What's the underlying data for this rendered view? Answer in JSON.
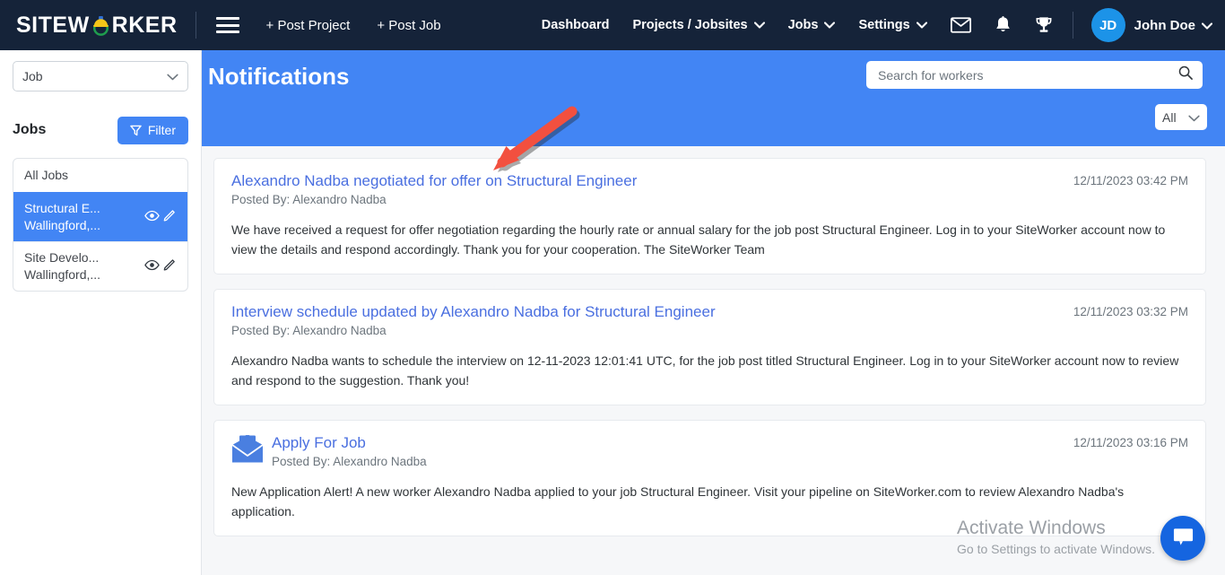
{
  "navbar": {
    "logo_text_left": "SITEW",
    "logo_icon": "safety-helmet-o-icon",
    "logo_text_right": "RKER",
    "menu_icon": "hamburger-icon",
    "post_project": "+ Post Project",
    "post_job": "+ Post Job",
    "items": [
      {
        "label": "Dashboard",
        "caret": false
      },
      {
        "label": "Projects / Jobsites",
        "caret": true
      },
      {
        "label": "Jobs",
        "caret": true
      },
      {
        "label": "Settings",
        "caret": true
      }
    ],
    "icons": [
      "mail-icon",
      "bell-icon",
      "trophy-icon"
    ],
    "avatar_initials": "JD",
    "username": "John Doe",
    "caret_glyph": "∨"
  },
  "sidebar": {
    "entity_select": {
      "value": "Job",
      "caret": "⌄"
    },
    "jobs_label": "Jobs",
    "filter_button": "Filter",
    "jobs": [
      {
        "line1": "All Jobs",
        "line2": "",
        "active": false,
        "icons": false
      },
      {
        "line1": "Structural E...",
        "line2": "Wallingford,...",
        "active": true,
        "icons": true
      },
      {
        "line1": "Site Develo...",
        "line2": "Wallingford,...",
        "active": false,
        "icons": true
      }
    ]
  },
  "header": {
    "title": "Notifications",
    "search_placeholder": "Search for workers",
    "search_value": "",
    "search_icon": "search-icon",
    "filter_select_value": "All"
  },
  "notifications": [
    {
      "icon": null,
      "title": "Alexandro Nadba negotiated for offer on Structural Engineer",
      "posted_by": "Posted By: Alexandro Nadba",
      "time": "12/11/2023 03:42 PM",
      "body": "We have received a request for offer negotiation regarding the hourly rate or annual salary for the job post Structural Engineer. Log in to your SiteWorker account now to view the details and respond accordingly. Thank you for your cooperation. The SiteWorker Team"
    },
    {
      "icon": null,
      "title": "Interview schedule updated by Alexandro Nadba for Structural Engineer",
      "posted_by": "Posted By: Alexandro Nadba",
      "time": "12/11/2023 03:32 PM",
      "body": "Alexandro Nadba wants to schedule the interview on 12-11-2023 12:01:41 UTC, for the job post titled Structural Engineer. Log in to your SiteWorker account now to review and respond to the suggestion. Thank you!"
    },
    {
      "icon": "open-envelope-icon",
      "title": "Apply For Job",
      "posted_by": "Posted By: Alexandro Nadba",
      "time": "12/11/2023 03:16 PM",
      "body": "New Application Alert! A new worker Alexandro Nadba applied to your job Structural Engineer. Visit your pipeline on SiteWorker.com to review Alexandro Nadba's application."
    }
  ],
  "annotation": {
    "type": "red-arrow",
    "color": "#f2503f"
  },
  "watermark": {
    "line1": "Activate Windows",
    "line2": "Go to Settings to activate Windows."
  },
  "chat_fab": {
    "icon": "chat-bubble-icon"
  },
  "colors": {
    "navbar_bg": "#152339",
    "accent_blue": "#4285f4",
    "avatar_blue": "#1c93e8",
    "link_blue": "#4a6fe0",
    "arrow_red": "#f2503f"
  }
}
